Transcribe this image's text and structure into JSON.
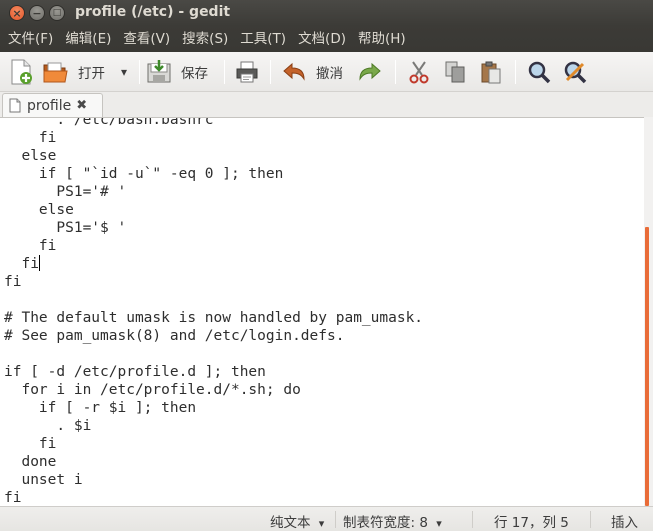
{
  "window": {
    "title": "profile (/etc) - gedit",
    "close_glyph": "×",
    "minimize_glyph": "−",
    "maximize_glyph": "□"
  },
  "menubar": {
    "items": [
      "文件(F)",
      "编辑(E)",
      "查看(V)",
      "搜索(S)",
      "工具(T)",
      "文档(D)",
      "帮助(H)"
    ]
  },
  "toolbar": {
    "open_label": "打开",
    "open_dropdown_glyph": "▾",
    "save_label": "保存",
    "undo_label": "撤消",
    "icons": [
      "new-document-icon",
      "open-folder-icon",
      "save-icon",
      "print-icon",
      "undo-icon",
      "redo-icon",
      "cut-icon",
      "copy-icon",
      "paste-icon",
      "search-icon",
      "replace-icon"
    ]
  },
  "tab": {
    "label": "profile",
    "close_glyph": "✖"
  },
  "editor": {
    "lines": [
      "      . /etc/bash.bashrc",
      "    fi",
      "  else",
      "    if [ \"`id -u`\" -eq 0 ]; then",
      "      PS1='# '",
      "    else",
      "      PS1='$ '",
      "    fi",
      "  fi",
      "fi",
      "",
      "# The default umask is now handled by pam_umask.",
      "# See pam_umask(8) and /etc/login.defs.",
      "",
      "if [ -d /etc/profile.d ]; then",
      "  for i in /etc/profile.d/*.sh; do",
      "    if [ -r $i ]; then",
      "      . $i",
      "    fi",
      "  done",
      "  unset i",
      "fi"
    ],
    "cursor_line": 8
  },
  "statusbar": {
    "language": "纯文本",
    "tab_width": "制表符宽度: 8",
    "dropdown_glyph": "▾",
    "position": "行 17，列 5",
    "mode": "插入"
  },
  "colors": {
    "titlebar": "#3c3b37",
    "accent_scrollbar": "#e96c38",
    "close_button": "#e1562a"
  }
}
